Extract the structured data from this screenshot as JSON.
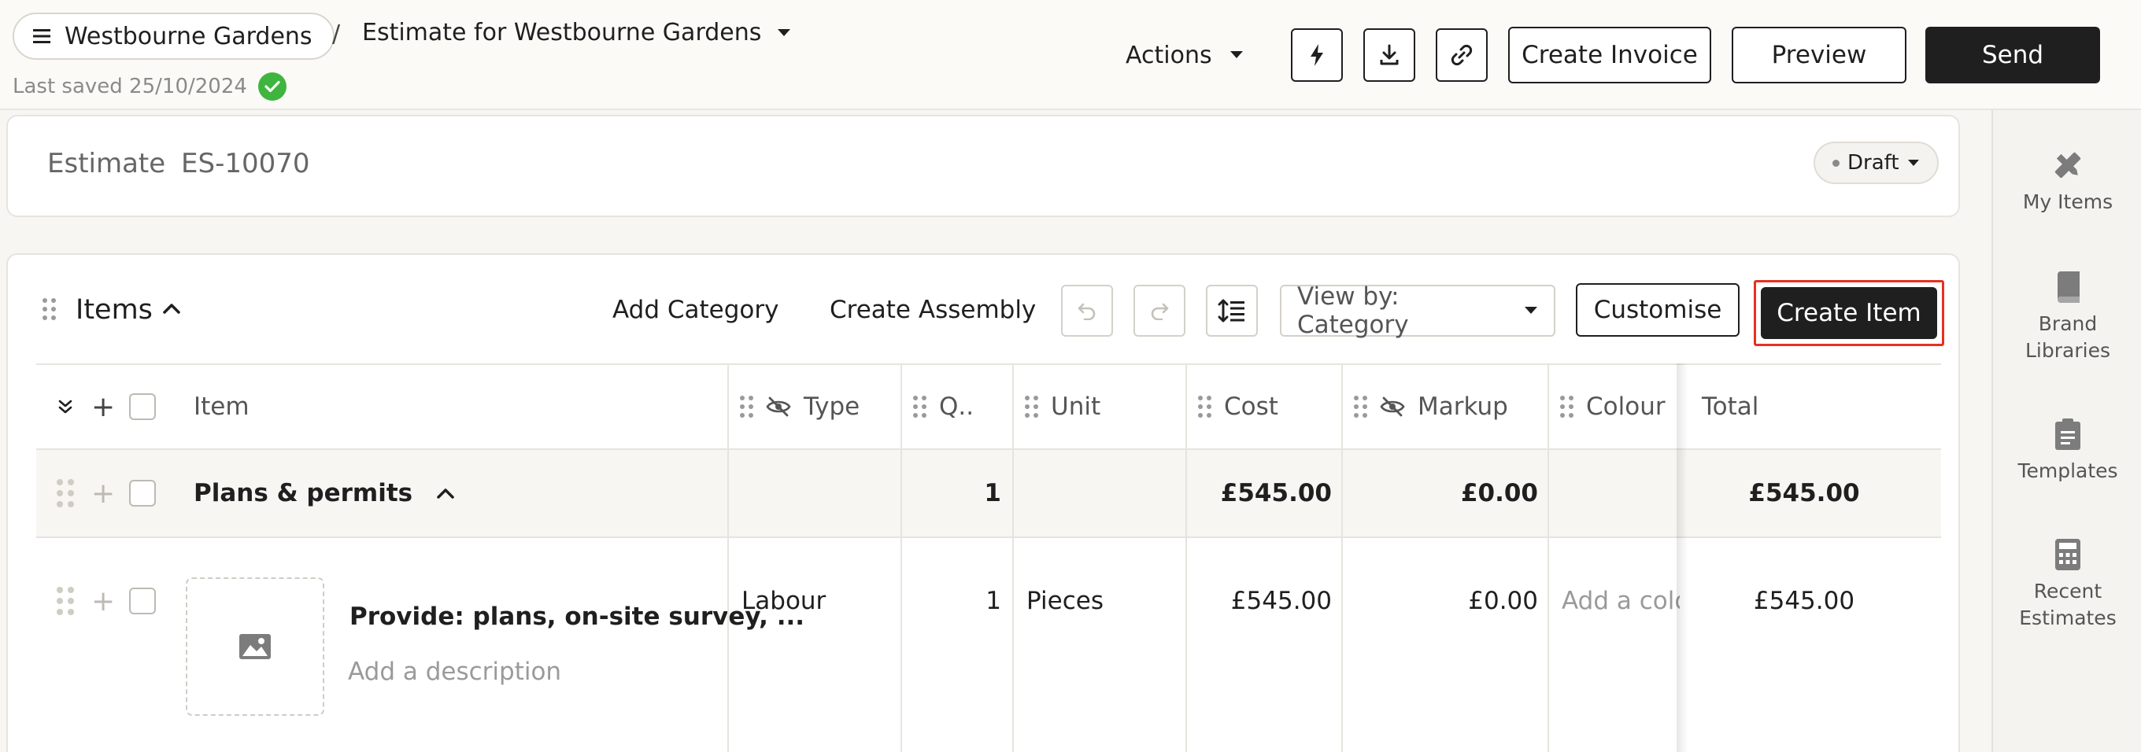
{
  "header": {
    "project_name": "Westbourne Gardens",
    "separator": "/",
    "document_title": "Estimate for Westbourne Gardens",
    "last_saved": "Last saved 25/10/2024",
    "actions_label": "Actions",
    "create_invoice_label": "Create Invoice",
    "preview_label": "Preview",
    "send_label": "Send"
  },
  "right_panel": {
    "items": [
      {
        "icon": "ruler-pencil-icon",
        "label": "My Items"
      },
      {
        "icon": "book-icon",
        "label": "Brand Libraries"
      },
      {
        "icon": "clipboard-icon",
        "label": "Templates"
      },
      {
        "icon": "calculator-icon",
        "label": "Recent Estimates"
      }
    ]
  },
  "estimate": {
    "label": "Estimate",
    "number": "ES-10070",
    "status": "Draft"
  },
  "items_section": {
    "title": "Items",
    "add_category_label": "Add Category",
    "create_assembly_label": "Create Assembly",
    "view_by_label": "View by: Category",
    "customise_label": "Customise",
    "create_item_label": "Create Item"
  },
  "table": {
    "columns": {
      "item": "Item",
      "type": "Type",
      "qty": "Q..",
      "unit": "Unit",
      "cost": "Cost",
      "markup": "Markup",
      "colour": "Colour",
      "total": "Total"
    },
    "category_row": {
      "name": "Plans & permits",
      "qty": "1",
      "cost": "£545.00",
      "markup": "£0.00",
      "total": "£545.00"
    },
    "item_row": {
      "name": "Provide: plans, on-site survey, ...",
      "description_placeholder": "Add a description",
      "type": "Labour",
      "qty": "1",
      "unit": "Pieces",
      "cost": "£545.00",
      "markup": "£0.00",
      "colour_placeholder": "Add a colo",
      "total": "£545.00"
    }
  },
  "colors": {
    "accent_dark": "#1f1f1f",
    "highlight_red": "#e8301f",
    "success_green": "#3fb53f"
  }
}
